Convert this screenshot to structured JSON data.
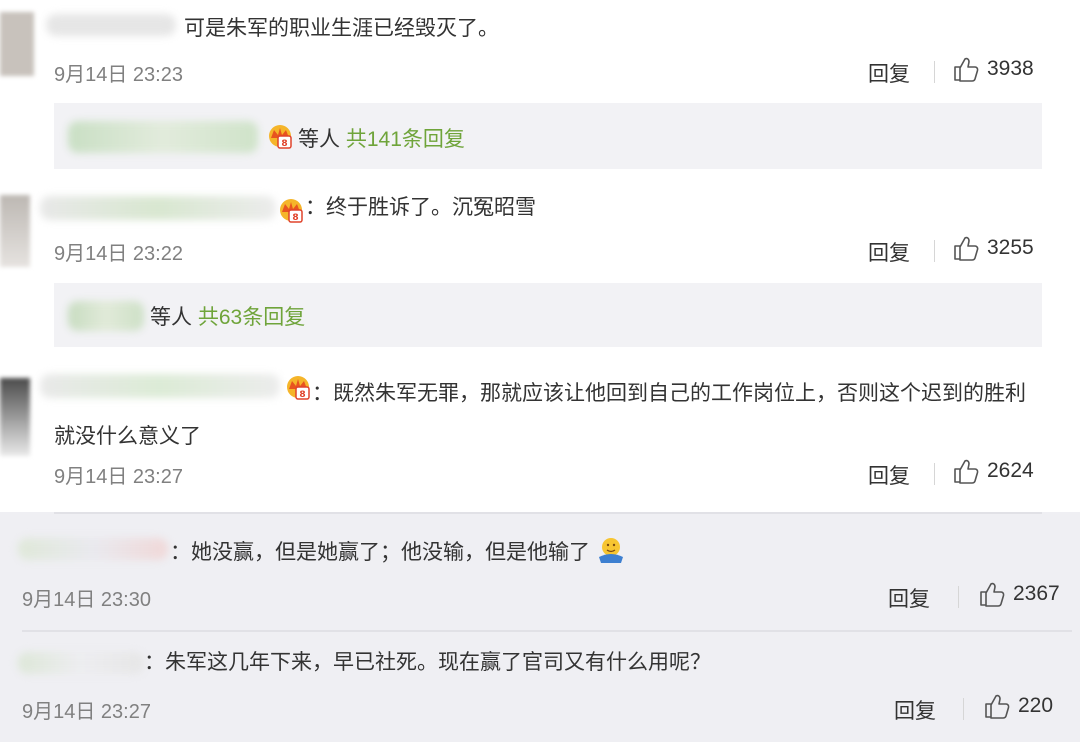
{
  "comments": [
    {
      "text": "可是朱军的职业生涯已经毁灭了。",
      "time": "9月14日 23:23",
      "reply_label": "回复",
      "likes": "3938",
      "sub": {
        "suffix": "等人",
        "count": "共141条回复"
      }
    },
    {
      "text": "：终于胜诉了。沉冤昭雪",
      "time": "9月14日 23:22",
      "reply_label": "回复",
      "likes": "3255",
      "sub": {
        "suffix": "等人",
        "count": "共63条回复"
      }
    },
    {
      "text": "：既然朱军无罪，那就应该让他回到自己的工作岗位上，否则这个迟到的胜利就没什么意义了",
      "time": "9月14日 23:27",
      "reply_label": "回复",
      "likes": "2624"
    },
    {
      "text": "：她没赢，但是她赢了；他没输，但是他输了",
      "time": "9月14日 23:30",
      "reply_label": "回复",
      "likes": "2367"
    },
    {
      "text": "：朱军这几年下来，早已社死。现在赢了官司又有什么用呢？",
      "time": "9月14日 23:27",
      "reply_label": "回复",
      "likes": "220"
    }
  ],
  "icons": {
    "like": "thumbs-up-icon",
    "crown": "vip-crown-icon",
    "emoji": "shrug-emoji-icon"
  },
  "colors": {
    "reply_count": "#6fa43a",
    "time": "#808080",
    "reply_box_bg": "#f2f2f5",
    "crown_orange": "#f0a020",
    "crown_red": "#e0432b"
  }
}
